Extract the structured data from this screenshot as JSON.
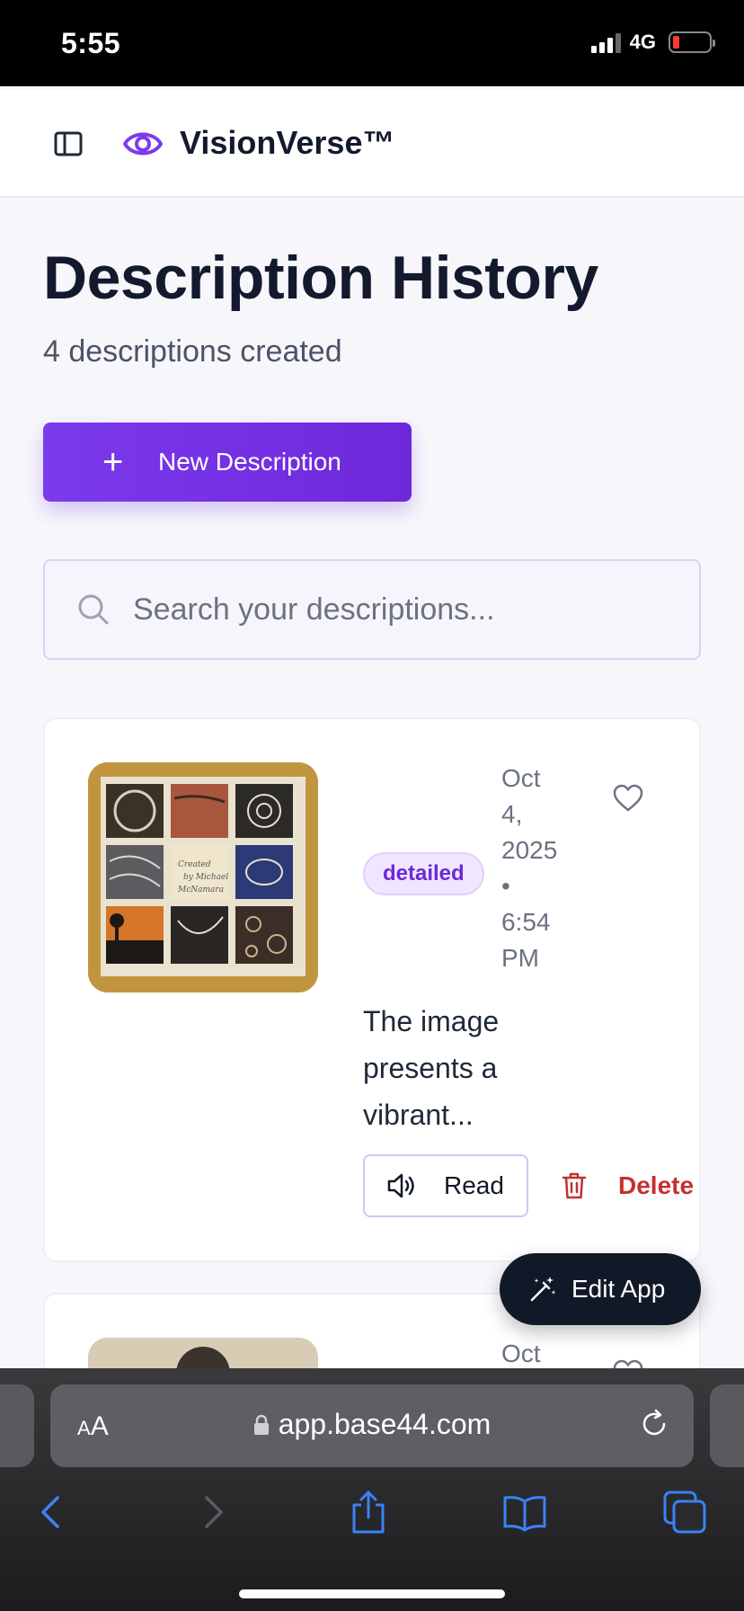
{
  "status_bar": {
    "time": "5:55",
    "network": "4G",
    "battery_level": 0.1
  },
  "header": {
    "brand": "VisionVerse™",
    "icons": [
      "sidebar-icon",
      "eye-icon"
    ],
    "accent_color": "#7c3aed"
  },
  "page": {
    "title": "Description History",
    "subtitle": "4 descriptions created",
    "new_button_label": "New Description",
    "new_button_icon": "plus-icon"
  },
  "search": {
    "placeholder": "Search your descriptions...",
    "value": ""
  },
  "descriptions": [
    {
      "badge": "detailed",
      "date_lines": [
        "Oct",
        "4,",
        "2025",
        "•",
        "6:54",
        "PM"
      ],
      "excerpt": "The image presents a vibrant...",
      "read_label": "Read",
      "delete_label": "Delete",
      "favorited": false
    },
    {
      "date_lines": [
        "Oct"
      ]
    }
  ],
  "fab": {
    "label": "Edit App",
    "icon": "magic-wand-icon"
  },
  "browser": {
    "aa_label_small": "A",
    "aa_label_large": "A",
    "url": "app.base44.com"
  }
}
